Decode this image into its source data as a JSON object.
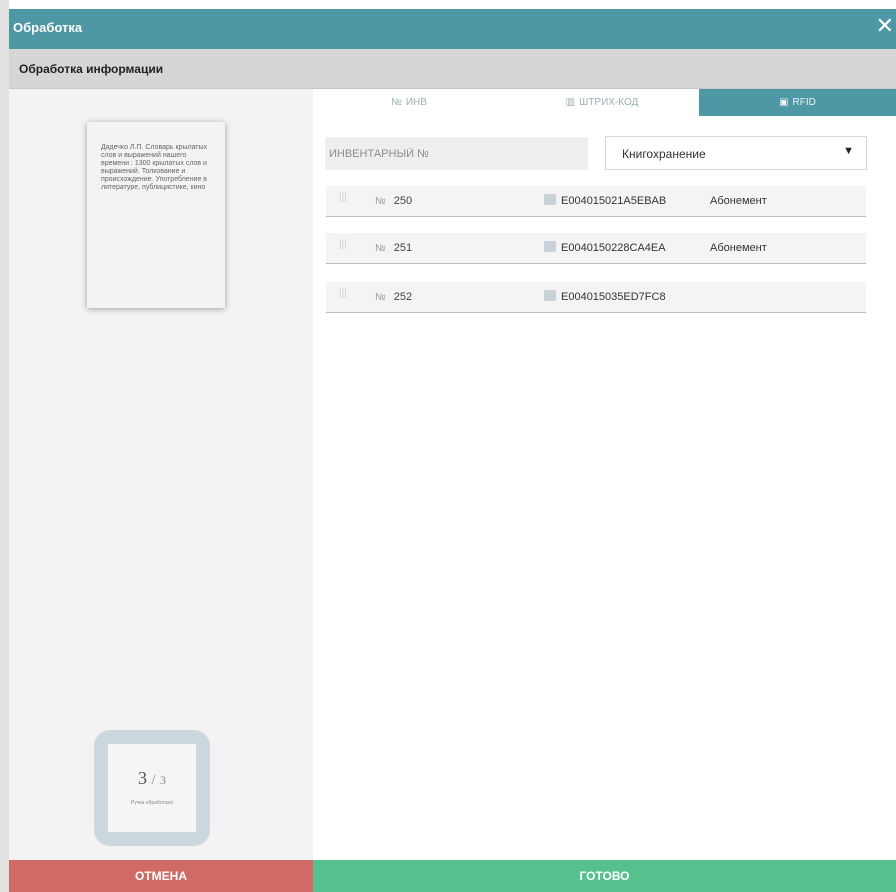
{
  "window": {
    "title": "Обработка",
    "close_icon": "close-icon"
  },
  "subheader": {
    "title": "Обработка информации"
  },
  "book": {
    "description": "Дядечко Л.П. Словарь крылатых слов и выражений нашего времени : 1300 крылатых слов и выражений. Толкование и происхождение. Употребление в литературе, публицистике, кино"
  },
  "counter": {
    "current": "3",
    "separator": "/",
    "total": "3",
    "caption": "Ручка обработано"
  },
  "tabs": [
    {
      "icon": "№",
      "label": "ИНВ",
      "active": false
    },
    {
      "icon": "▥",
      "label": "ШТРИХ-КОД",
      "active": false
    },
    {
      "icon": "▣",
      "label": "RFID",
      "active": true
    }
  ],
  "search": {
    "placeholder": "ИНВЕНТАРНЫЙ №",
    "value": ""
  },
  "storage_select": {
    "selected": "Книгохранение"
  },
  "items": [
    {
      "num_symbol": "№",
      "number": "250",
      "rfid": "E004015021A5EBAB",
      "location": "Абонемент"
    },
    {
      "num_symbol": "№",
      "number": "251",
      "rfid": "E0040150228CA4EA",
      "location": "Абонемент"
    },
    {
      "num_symbol": "№",
      "number": "252",
      "rfid": "E004015035ED7FC8",
      "location": ""
    }
  ],
  "footer": {
    "cancel_label": "ОТМЕНА",
    "done_label": "ГОТОВО"
  },
  "colors": {
    "header": "#4e97a4",
    "cancel": "#d06a64",
    "done": "#56c18f",
    "panel": "#f3f3f3"
  }
}
